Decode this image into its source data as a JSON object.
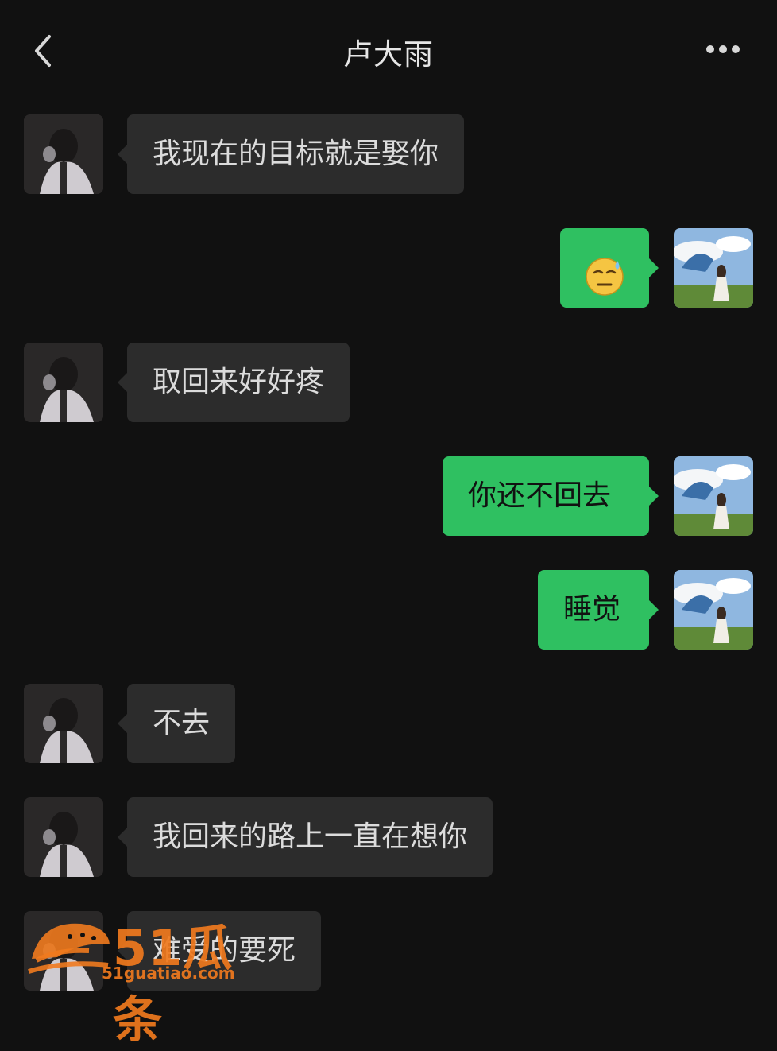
{
  "header": {
    "title": "卢大雨",
    "back_icon": "chevron-left-icon",
    "more_icon": "more-dots-icon"
  },
  "messages": [
    {
      "side": "in",
      "text": "我现在的目标就是娶你"
    },
    {
      "side": "out",
      "emoji": "sweat-smile-emoji"
    },
    {
      "side": "in",
      "text": "取回来好好疼"
    },
    {
      "side": "out",
      "text": "你还不回去"
    },
    {
      "side": "out",
      "text": "睡觉"
    },
    {
      "side": "in",
      "text": "不去"
    },
    {
      "side": "in",
      "text": "我回来的路上一直在想你"
    },
    {
      "side": "in",
      "text": "难受的要死"
    }
  ],
  "watermark": {
    "brand": "51瓜条",
    "url": "51guatiao.com"
  },
  "colors": {
    "background": "#111111",
    "incoming_bubble": "#2c2c2c",
    "outgoing_bubble": "#2fc061",
    "watermark": "#f07a1e"
  }
}
